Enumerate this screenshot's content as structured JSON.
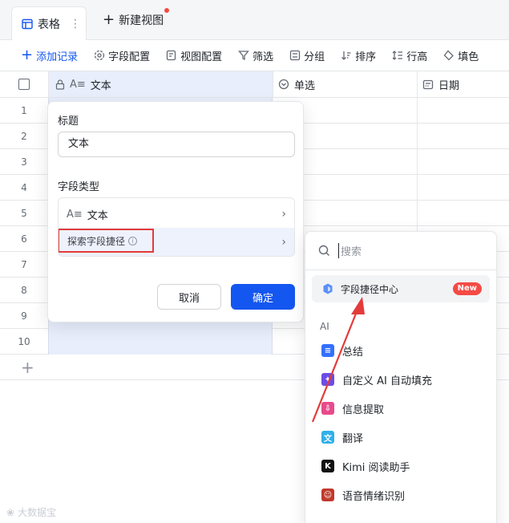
{
  "tabs": {
    "active": "表格",
    "more": "⋮",
    "new_view": "新建视图"
  },
  "toolbar": {
    "add_record": "添加记录",
    "field_config": "字段配置",
    "view_config": "视图配置",
    "filter": "筛选",
    "group": "分组",
    "sort": "排序",
    "row_height": "行高",
    "fill": "填色"
  },
  "columns": {
    "text": "文本",
    "select": "单选",
    "date": "日期"
  },
  "rows": [
    "1",
    "2",
    "3",
    "4",
    "5",
    "6",
    "7",
    "8",
    "9",
    "10"
  ],
  "popup": {
    "title_label": "标题",
    "title_value": "文本",
    "type_label": "字段类型",
    "type_value": "文本",
    "explore": "探索字段捷径",
    "cancel": "取消",
    "confirm": "确定"
  },
  "dropdown": {
    "search_placeholder": "搜索",
    "center": "字段捷径中心",
    "new_badge": "New",
    "group_ai": "AI",
    "items": [
      "总结",
      "自定义 AI 自动填充",
      "信息提取",
      "翻译",
      "Kimi 阅读助手",
      "语音情绪识别"
    ]
  },
  "watermark": "大数据宝",
  "colors": {
    "accent": "#1456f0",
    "highlight": "#e33b3b",
    "column_selected": "#e8eefc"
  }
}
